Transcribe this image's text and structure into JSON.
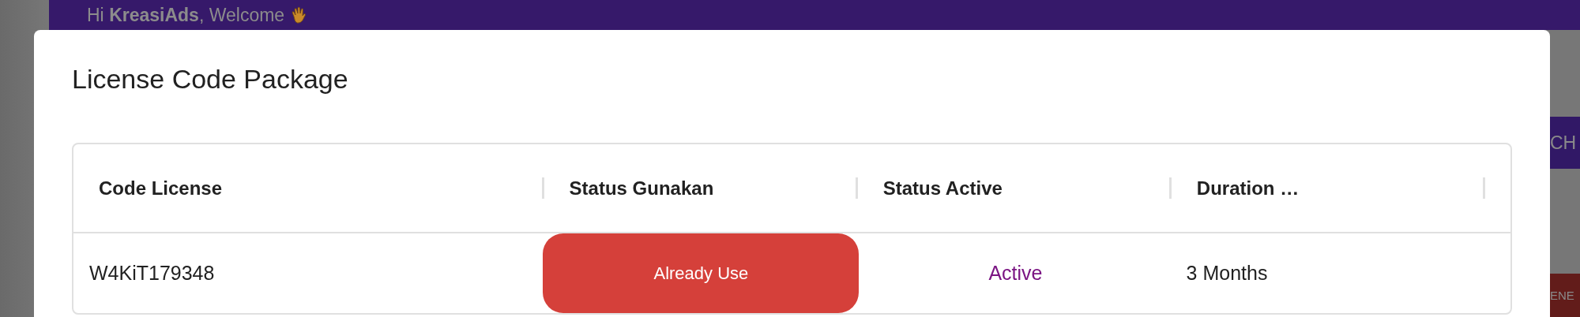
{
  "header": {
    "greeting": "Hi **KreasiAds**, Welcome"
  },
  "background_buttons": [
    {
      "label": "CH",
      "kind": "primary"
    },
    {
      "label": "ENE",
      "kind": "danger"
    }
  ],
  "dialog": {
    "title": "License Code Package",
    "table": {
      "columns": [
        "Code License",
        "Status Gunakan",
        "Status Active",
        "Duration …"
      ],
      "rows": [
        {
          "code": "W4KiT179348",
          "use_status": "Already Use",
          "used": true,
          "active_status": "Active",
          "active": true,
          "duration": "3 Months"
        }
      ]
    }
  }
}
